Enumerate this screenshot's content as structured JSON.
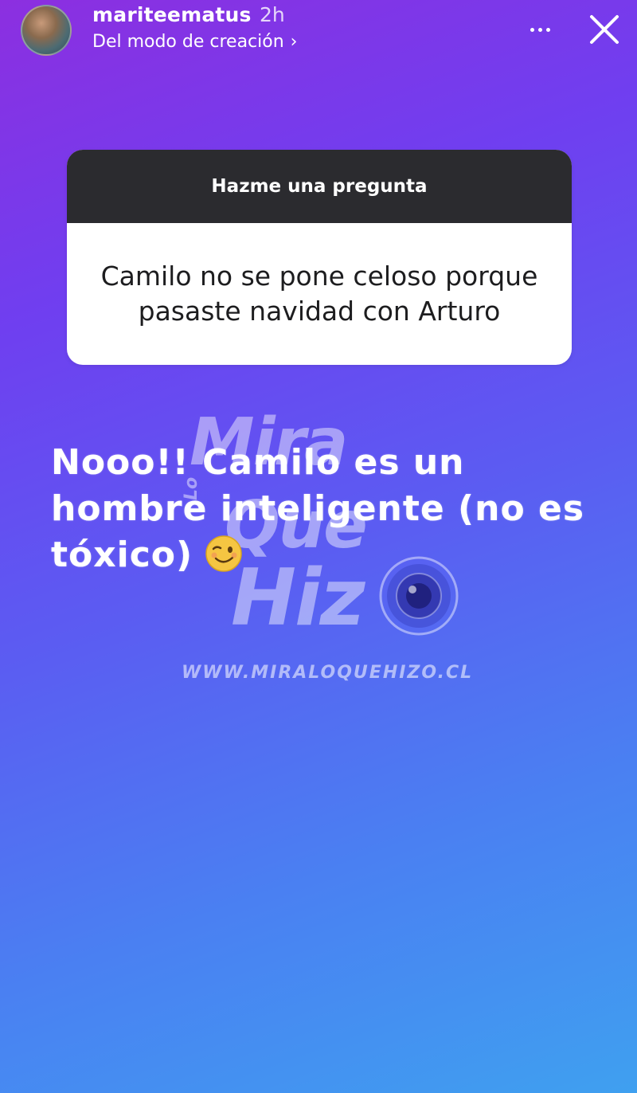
{
  "header": {
    "username": "mariteematus",
    "timestamp": "2h",
    "subtitle": "Del modo de creación",
    "subtitle_chevron": "›",
    "more_icon": "more-horizontal-icon",
    "close_icon": "close-icon"
  },
  "question_sticker": {
    "title": "Hazme una pregunta",
    "question": "Camilo no se pone celoso porque pasaste navidad con Arturo"
  },
  "story_text": {
    "line1": "Nooo!! Camilo es un",
    "line2": "hombre inteligente (no es",
    "line3": "tóxico)",
    "emoji": "winking-face-emoji"
  },
  "watermark": {
    "word1": "Mira",
    "word2": "Lo",
    "word3": "Que",
    "word4": "Hiz",
    "url": "WWW.MIRALOQUEHIZO.CL"
  },
  "colors": {
    "gradient_top": "#8c2fe0",
    "gradient_bottom": "#3fa0f0",
    "sticker_header": "#2b2b2f",
    "sticker_body": "#ffffff"
  }
}
